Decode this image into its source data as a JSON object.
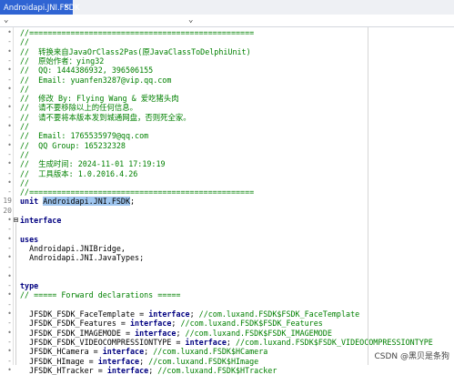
{
  "tab": {
    "title": "Androidapi.JNI.FSDK",
    "close_glyph": "×"
  },
  "dropdowns": {
    "left_arrow": "⌄",
    "right_arrow": "⌄"
  },
  "watermark": "CSDN @黑贝是条狗",
  "editor": {
    "lines": [
      {
        "ln": "•",
        "segs": [
          {
            "t": "//=================================================",
            "c": "cmt"
          }
        ]
      },
      {
        "ln": "-",
        "segs": [
          {
            "t": "//",
            "c": "cmt"
          }
        ]
      },
      {
        "ln": "•",
        "segs": [
          {
            "t": "//  转换来自JavaOrClass2Pas(原JavaClassToDelphiUnit)",
            "c": "cmt"
          }
        ]
      },
      {
        "ln": "-",
        "segs": [
          {
            "t": "//  原始作者：ying32",
            "c": "cmt"
          }
        ]
      },
      {
        "ln": "•",
        "segs": [
          {
            "t": "//  QQ: 1444386932, 396506155",
            "c": "cmt"
          }
        ]
      },
      {
        "ln": "-",
        "segs": [
          {
            "t": "//  Email: yuanfen3287@vip.qq.com",
            "c": "cmt"
          }
        ]
      },
      {
        "ln": "•",
        "segs": [
          {
            "t": "//",
            "c": "cmt"
          }
        ]
      },
      {
        "ln": "-",
        "segs": [
          {
            "t": "//  修改 By: Flying Wang & 爱吃猪头肉",
            "c": "cmt"
          }
        ]
      },
      {
        "ln": "•",
        "segs": [
          {
            "t": "//  请不要移除以上的任何信息。",
            "c": "cmt"
          }
        ]
      },
      {
        "ln": "-",
        "segs": [
          {
            "t": "//  请不要将本版本发到城通网盘，否则死全家。",
            "c": "cmt"
          }
        ]
      },
      {
        "ln": "•",
        "segs": [
          {
            "t": "//",
            "c": "cmt"
          }
        ]
      },
      {
        "ln": "-",
        "segs": [
          {
            "t": "//  Email: 1765535979@qq.com",
            "c": "cmt"
          }
        ]
      },
      {
        "ln": "•",
        "segs": [
          {
            "t": "//  QQ Group: 165232328",
            "c": "cmt"
          }
        ]
      },
      {
        "ln": "-",
        "segs": [
          {
            "t": "//",
            "c": "cmt"
          }
        ]
      },
      {
        "ln": "•",
        "segs": [
          {
            "t": "//  生成时间: 2024-11-01 17:19:19",
            "c": "cmt"
          }
        ]
      },
      {
        "ln": "-",
        "segs": [
          {
            "t": "//  工具版本: 1.0.2016.4.26",
            "c": "cmt"
          }
        ]
      },
      {
        "ln": "•",
        "segs": [
          {
            "t": "//",
            "c": "cmt"
          }
        ]
      },
      {
        "ln": "-",
        "segs": [
          {
            "t": "//=================================================",
            "c": "cmt"
          }
        ]
      },
      {
        "ln": "19",
        "segs": [
          {
            "t": "unit",
            "c": "kw"
          },
          {
            "t": " ",
            "c": ""
          },
          {
            "t": "Androidapi.JNI.FSDK",
            "c": "sel"
          },
          {
            "t": ";",
            "c": ""
          }
        ]
      },
      {
        "ln": "20",
        "segs": []
      },
      {
        "ln": "•",
        "fold": true,
        "segs": [
          {
            "t": "interface",
            "c": "kw"
          }
        ]
      },
      {
        "ln": "-",
        "segs": []
      },
      {
        "ln": "•",
        "segs": [
          {
            "t": "uses",
            "c": "kw"
          }
        ]
      },
      {
        "ln": "-",
        "segs": [
          {
            "t": "  Androidapi.JNIBridge,",
            "c": ""
          }
        ]
      },
      {
        "ln": "•",
        "segs": [
          {
            "t": "  Androidapi.JNI.JavaTypes;",
            "c": ""
          }
        ]
      },
      {
        "ln": "-",
        "segs": []
      },
      {
        "ln": "•",
        "segs": []
      },
      {
        "ln": "-",
        "segs": [
          {
            "t": "type",
            "c": "kw"
          }
        ]
      },
      {
        "ln": "•",
        "segs": [
          {
            "t": "// ===== Forward declarations =====",
            "c": "cmt"
          }
        ]
      },
      {
        "ln": "-",
        "segs": []
      },
      {
        "ln": "•",
        "segs": [
          {
            "t": "  JFSDK_FSDK_FaceTemplate = ",
            "c": ""
          },
          {
            "t": "interface",
            "c": "kw"
          },
          {
            "t": "; ",
            "c": ""
          },
          {
            "t": "//com.luxand.FSDK$FSDK_FaceTemplate",
            "c": "cmt"
          }
        ]
      },
      {
        "ln": "-",
        "segs": [
          {
            "t": "  JFSDK_FSDK_Features = ",
            "c": ""
          },
          {
            "t": "interface",
            "c": "kw"
          },
          {
            "t": "; ",
            "c": ""
          },
          {
            "t": "//com.luxand.FSDK$FSDK_Features",
            "c": "cmt"
          }
        ]
      },
      {
        "ln": "•",
        "segs": [
          {
            "t": "  JFSDK_FSDK_IMAGEMODE = ",
            "c": ""
          },
          {
            "t": "interface",
            "c": "kw"
          },
          {
            "t": "; ",
            "c": ""
          },
          {
            "t": "//com.luxand.FSDK$FSDK_IMAGEMODE",
            "c": "cmt"
          }
        ]
      },
      {
        "ln": "-",
        "segs": [
          {
            "t": "  JFSDK_FSDK_VIDEOCOMPRESSIONTYPE = ",
            "c": ""
          },
          {
            "t": "interface",
            "c": "kw"
          },
          {
            "t": "; ",
            "c": ""
          },
          {
            "t": "//com.luxand.FSDK$FSDK_VIDEOCOMPRESSIONTYPE",
            "c": "cmt"
          }
        ]
      },
      {
        "ln": "•",
        "segs": [
          {
            "t": "  JFSDK_HCamera = ",
            "c": ""
          },
          {
            "t": "interface",
            "c": "kw"
          },
          {
            "t": "; ",
            "c": ""
          },
          {
            "t": "//com.luxand.FSDK$HCamera",
            "c": "cmt"
          }
        ]
      },
      {
        "ln": "-",
        "segs": [
          {
            "t": "  JFSDK_HImage = ",
            "c": ""
          },
          {
            "t": "interface",
            "c": "kw"
          },
          {
            "t": "; ",
            "c": ""
          },
          {
            "t": "//com.luxand.FSDK$HImage",
            "c": "cmt"
          }
        ]
      },
      {
        "ln": "•",
        "segs": [
          {
            "t": "  JFSDK_HTracker = ",
            "c": ""
          },
          {
            "t": "interface",
            "c": "kw"
          },
          {
            "t": "; ",
            "c": ""
          },
          {
            "t": "//com.luxand.FSDK$HTracker",
            "c": "cmt"
          }
        ]
      }
    ]
  }
}
